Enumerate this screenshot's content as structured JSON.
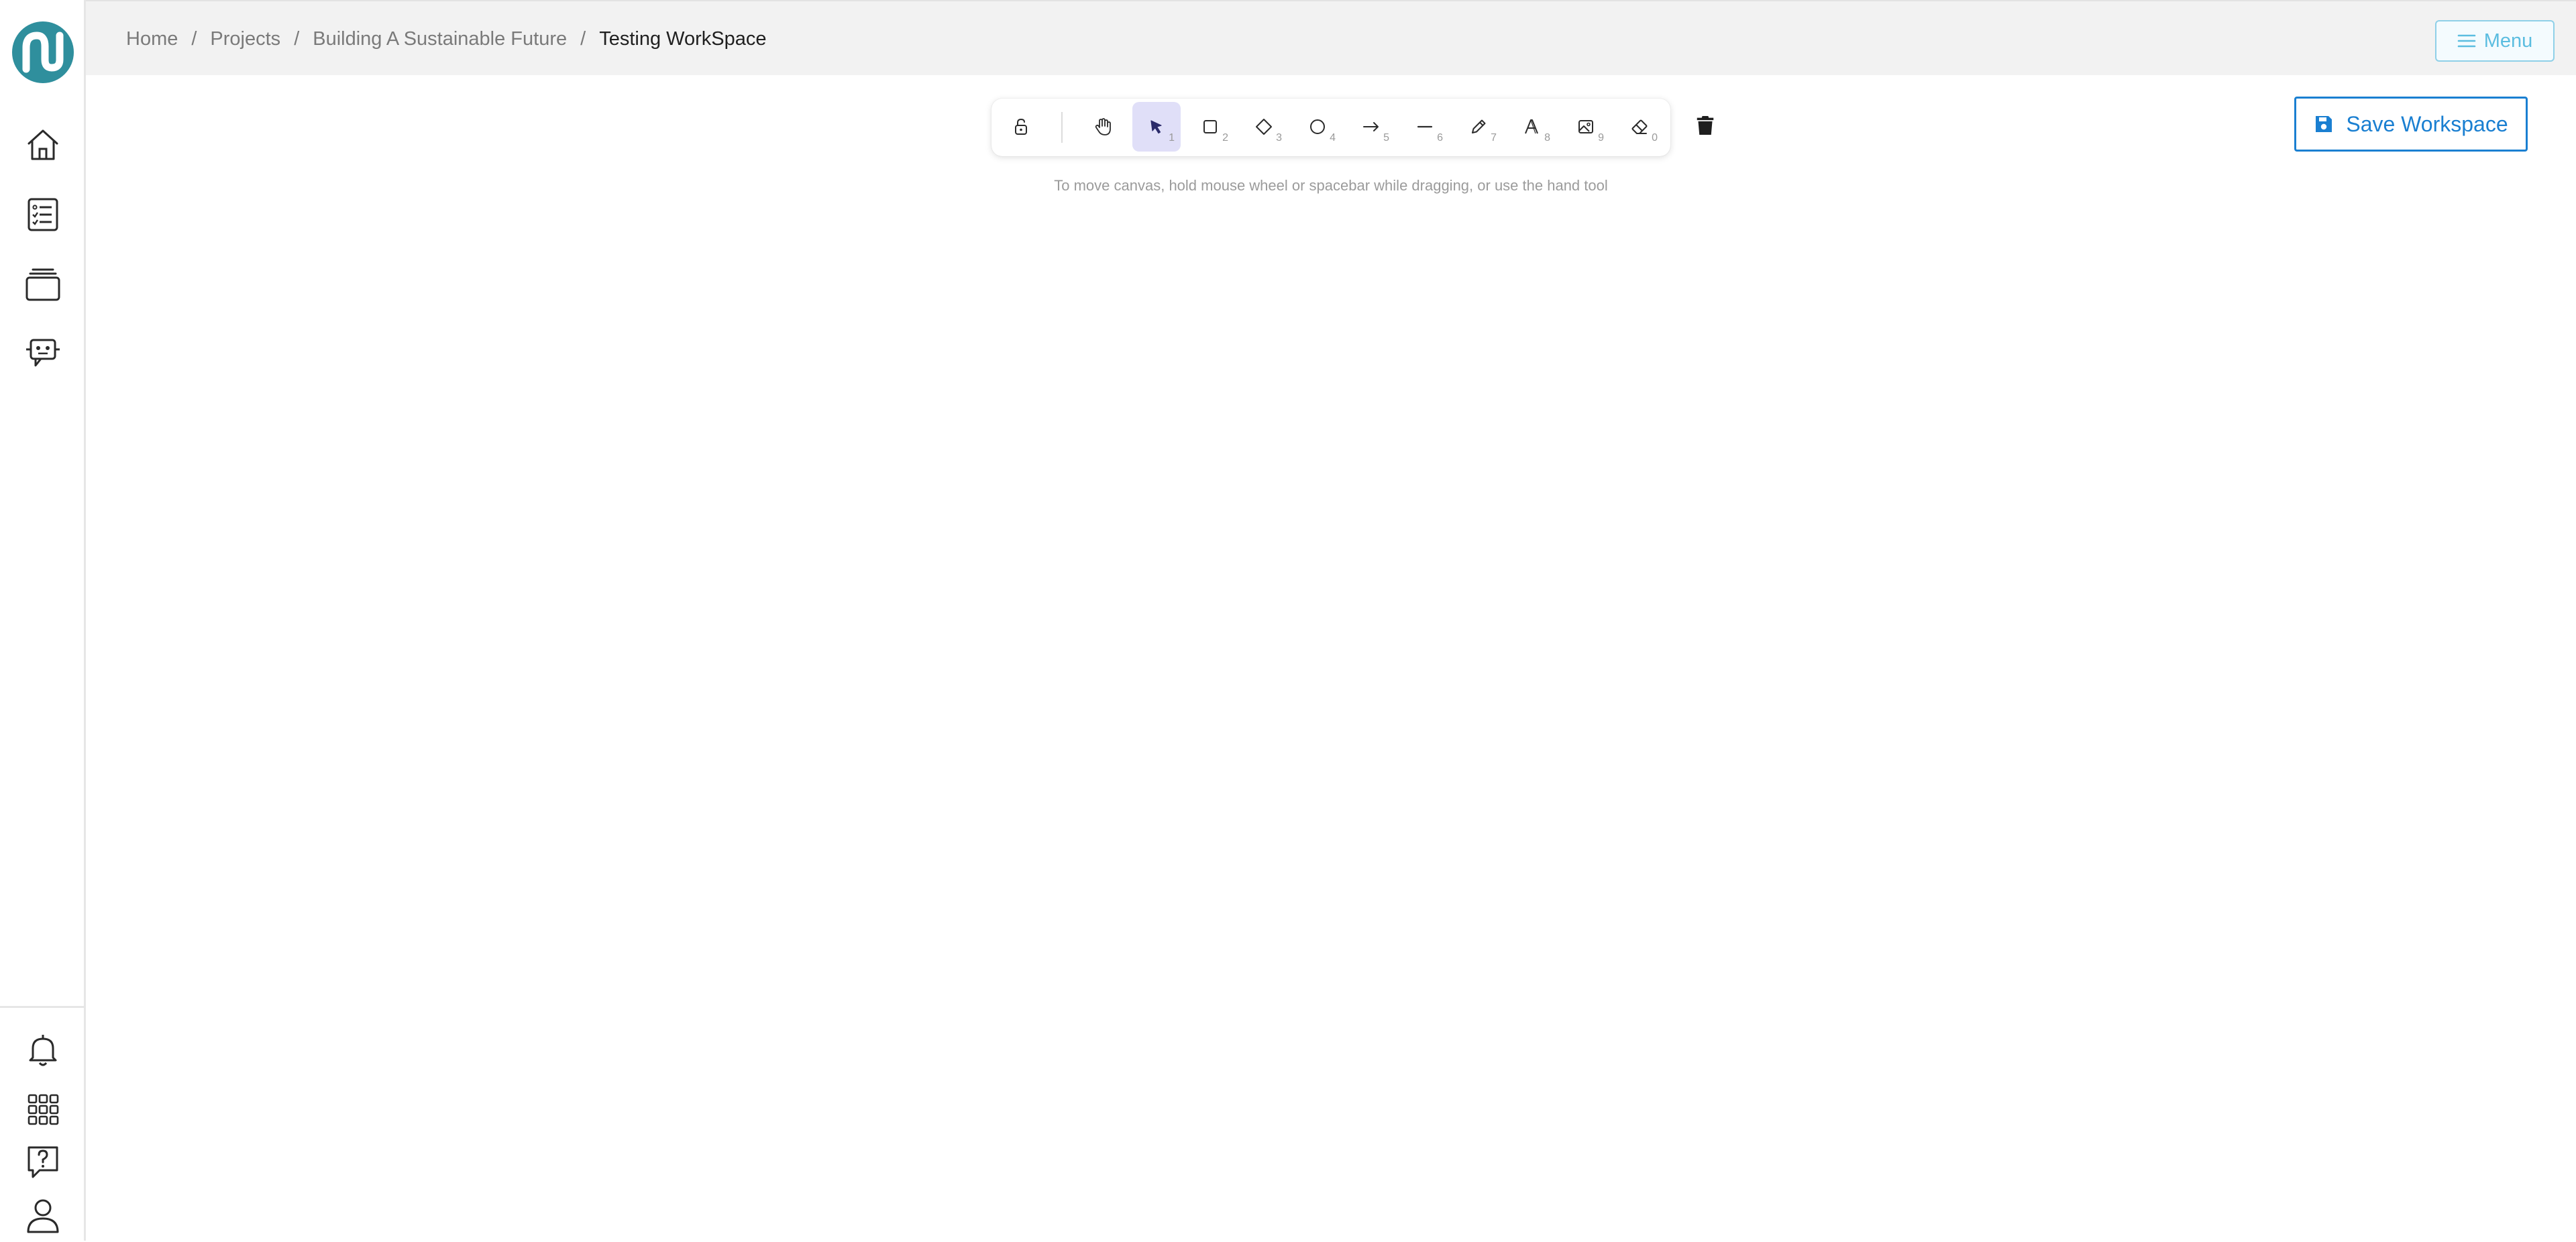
{
  "app": {
    "logo_icon": "nexus-logo-icon",
    "brand_color": "#2f8f9d"
  },
  "sidebar": {
    "top_items": [
      {
        "icon": "home-icon"
      },
      {
        "icon": "checklist-icon"
      },
      {
        "icon": "stacked-cards-icon"
      },
      {
        "icon": "ai-chat-bot-icon"
      }
    ],
    "bottom_items": [
      {
        "icon": "bell-icon"
      },
      {
        "icon": "apps-grid-icon"
      },
      {
        "icon": "help-question-icon"
      },
      {
        "icon": "user-profile-icon"
      }
    ]
  },
  "header": {
    "breadcrumb": {
      "home": "Home",
      "projects": "Projects",
      "project": "Building A Sustainable Future",
      "current": "Testing WorkSpace",
      "separator": "/"
    },
    "menu_label": "Menu",
    "menu_icon": "hamburger-icon",
    "menu_color": "#5bbde0"
  },
  "toolbar": {
    "tools": [
      {
        "icon": "lock-open-icon",
        "key": ""
      },
      {
        "icon": "hand-icon",
        "key": ""
      },
      {
        "icon": "pointer-icon",
        "key": "1",
        "active": true
      },
      {
        "icon": "rectangle-icon",
        "key": "2"
      },
      {
        "icon": "diamond-icon",
        "key": "3"
      },
      {
        "icon": "circle-icon",
        "key": "4"
      },
      {
        "icon": "arrow-icon",
        "key": "5"
      },
      {
        "icon": "line-icon",
        "key": "6"
      },
      {
        "icon": "pencil-icon",
        "key": "7"
      },
      {
        "icon": "text-icon",
        "key": "8"
      },
      {
        "icon": "image-icon",
        "key": "9"
      },
      {
        "icon": "eraser-icon",
        "key": "0"
      }
    ],
    "active_color": "#e0dff8",
    "delete_icon": "trash-icon"
  },
  "canvas": {
    "hint": "To move canvas, hold mouse wheel or spacebar while dragging, or use the hand tool"
  },
  "save": {
    "label": "Save Workspace",
    "icon": "save-icon",
    "color": "#1a7fd1"
  }
}
